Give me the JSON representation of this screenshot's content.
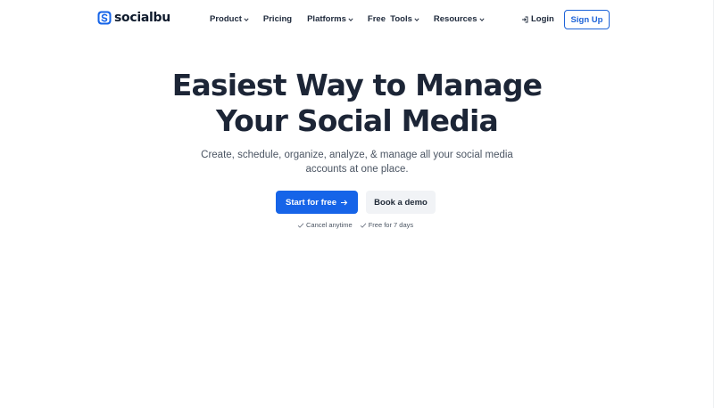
{
  "brand": {
    "name": "socialbu",
    "accent_color": "#1664e8"
  },
  "nav": {
    "items": [
      {
        "label": "Product",
        "has_dropdown": true,
        "icon": "chevron-down-icon"
      },
      {
        "label": "Pricing",
        "has_dropdown": false
      },
      {
        "label": "Platforms",
        "has_dropdown": true,
        "icon": "chevron-down-icon"
      },
      {
        "label": "Free  Tools",
        "has_dropdown": true,
        "icon": "chevron-down-icon"
      },
      {
        "label": "Resources",
        "has_dropdown": true,
        "icon": "chevron-down-icon"
      }
    ],
    "login_label": "Login",
    "login_icon": "login-icon",
    "signup_label": "Sign Up"
  },
  "hero": {
    "title_line1": "Easiest Way to Manage",
    "title_line2": "Your Social Media",
    "subtitle": "Create, schedule, organize, analyze, & manage all your social media accounts at one place.",
    "primary_cta": "Start for free",
    "primary_cta_icon": "arrow-right-icon",
    "secondary_cta": "Book a demo",
    "notes": [
      {
        "label": "Cancel anytime",
        "icon": "check-icon"
      },
      {
        "label": "Free for 7 days",
        "icon": "check-icon"
      }
    ]
  }
}
